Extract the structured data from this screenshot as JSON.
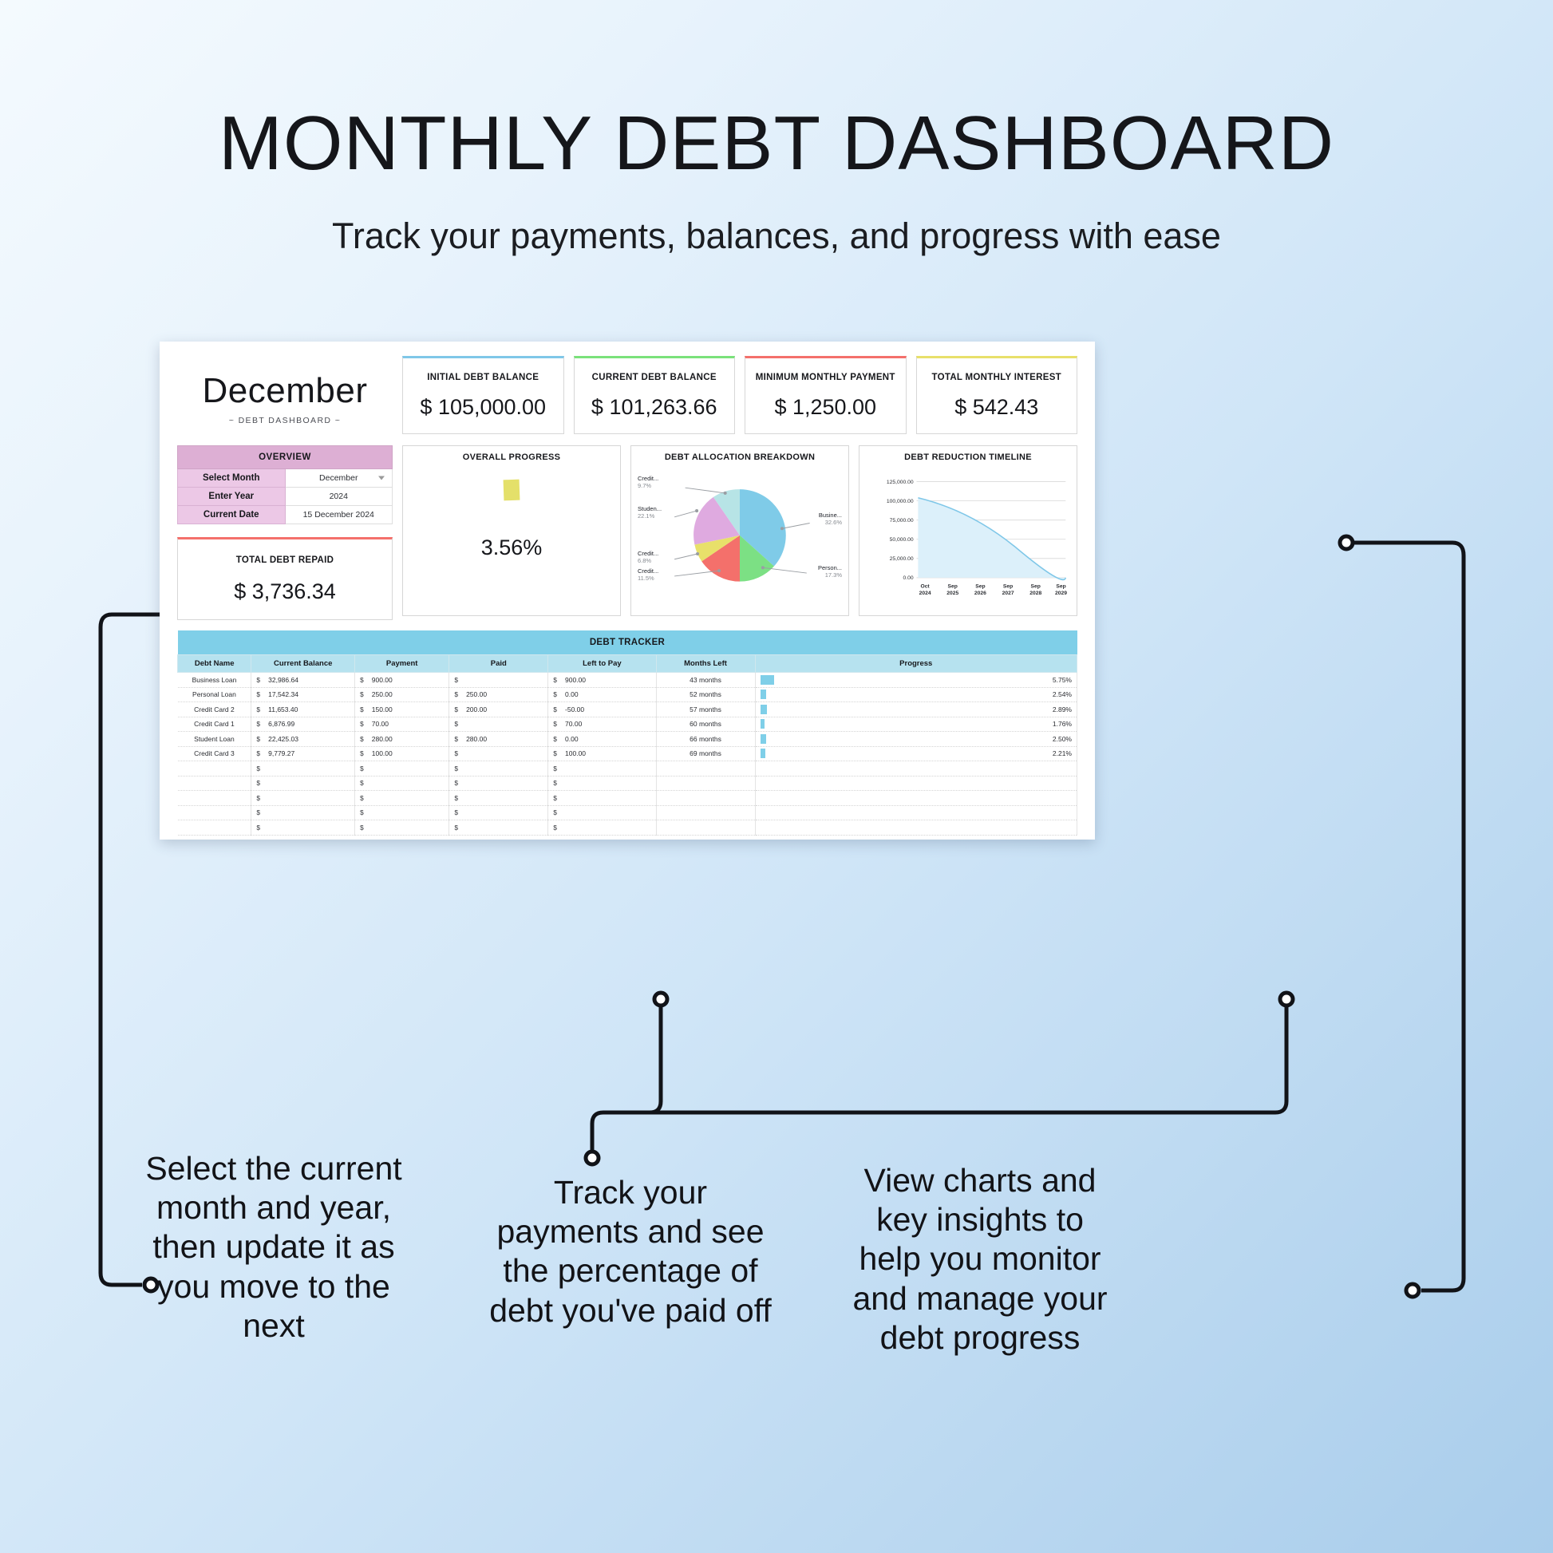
{
  "hero": {
    "title": "MONTHLY DEBT DASHBOARD",
    "subtitle": "Track your payments, balances, and progress with ease"
  },
  "dashboard": {
    "month": "December",
    "caption": "~ DEBT DASHBOARD ~",
    "kpis": [
      {
        "label": "INITIAL DEBT BALANCE",
        "value": "$ 105,000.00",
        "accent": "#7fc7e8"
      },
      {
        "label": "CURRENT DEBT BALANCE",
        "value": "$ 101,263.66",
        "accent": "#7ae27a"
      },
      {
        "label": "MINIMUM MONTHLY PAYMENT",
        "value": "$ 1,250.00",
        "accent": "#f4706b"
      },
      {
        "label": "TOTAL MONTHLY INTEREST",
        "value": "$ 542.43",
        "accent": "#e8e06a"
      }
    ],
    "overview": {
      "title": "OVERVIEW",
      "rows": [
        {
          "key": "Select Month",
          "value": "December",
          "dropdown": true
        },
        {
          "key": "Enter Year",
          "value": "2024",
          "dropdown": false
        },
        {
          "key": "Current Date",
          "value": "15 December 2024",
          "dropdown": false
        }
      ]
    },
    "total_repaid": {
      "label": "TOTAL DEBT REPAID",
      "value": "$ 3,736.34",
      "accent": "#f4706b"
    },
    "overall_progress": {
      "title": "OVERALL PROGRESS",
      "value": "3.56%"
    },
    "tracker": {
      "band": "DEBT TRACKER",
      "columns": [
        "Debt Name",
        "Current Balance",
        "Payment",
        "Paid",
        "Left to Pay",
        "Months Left",
        "Progress"
      ],
      "rows": [
        {
          "name": "Business Loan",
          "balance": "32,986.64",
          "payment": "900.00",
          "paid": "",
          "left": "900.00",
          "months": "43 months",
          "pct": "5.75%",
          "bar": 5.75
        },
        {
          "name": "Personal Loan",
          "balance": "17,542.34",
          "payment": "250.00",
          "paid": "250.00",
          "left": "0.00",
          "months": "52 months",
          "pct": "2.54%",
          "bar": 2.54
        },
        {
          "name": "Credit Card 2",
          "balance": "11,653.40",
          "payment": "150.00",
          "paid": "200.00",
          "left": "-50.00",
          "months": "57 months",
          "pct": "2.89%",
          "bar": 2.89
        },
        {
          "name": "Credit Card 1",
          "balance": "6,876.99",
          "payment": "70.00",
          "paid": "",
          "left": "70.00",
          "months": "60 months",
          "pct": "1.76%",
          "bar": 1.76
        },
        {
          "name": "Student Loan",
          "balance": "22,425.03",
          "payment": "280.00",
          "paid": "280.00",
          "left": "0.00",
          "months": "66 months",
          "pct": "2.50%",
          "bar": 2.5
        },
        {
          "name": "Credit Card 3",
          "balance": "9,779.27",
          "payment": "100.00",
          "paid": "",
          "left": "100.00",
          "months": "69 months",
          "pct": "2.21%",
          "bar": 2.21
        },
        {
          "name": "",
          "balance": "",
          "payment": "",
          "paid": "",
          "left": "",
          "months": "",
          "pct": "",
          "bar": 0
        },
        {
          "name": "",
          "balance": "",
          "payment": "",
          "paid": "",
          "left": "",
          "months": "",
          "pct": "",
          "bar": 0
        },
        {
          "name": "",
          "balance": "",
          "payment": "",
          "paid": "",
          "left": "",
          "months": "",
          "pct": "",
          "bar": 0
        },
        {
          "name": "",
          "balance": "",
          "payment": "",
          "paid": "",
          "left": "",
          "months": "",
          "pct": "",
          "bar": 0
        },
        {
          "name": "",
          "balance": "",
          "payment": "",
          "paid": "",
          "left": "",
          "months": "",
          "pct": "",
          "bar": 0
        }
      ],
      "currency_symbol": "$"
    }
  },
  "callouts": [
    {
      "text": "Select the current month and year, then update it as you move to the next"
    },
    {
      "text": "Track your payments and see the percentage of debt you've paid off"
    },
    {
      "text": "View charts and key insights to help you monitor and manage your debt progress"
    }
  ],
  "chart_data": [
    {
      "type": "pie",
      "title": "DEBT ALLOCATION BREAKDOWN",
      "labels": [
        "Busine...",
        "Person...",
        "Credit...",
        "Credit...",
        "Studen...",
        "Credit..."
      ],
      "values": [
        32.6,
        17.3,
        11.5,
        6.8,
        22.1,
        9.7
      ],
      "value_labels": [
        "32.6%",
        "17.3%",
        "11.5%",
        "6.8%",
        "22.1%",
        "9.7%"
      ],
      "colors": [
        "#7fcbe8",
        "#7ce084",
        "#f4706b",
        "#e8e06a",
        "#dfaae0",
        "#b7e4e6"
      ],
      "legend": "callouts"
    },
    {
      "type": "area",
      "title": "DEBT REDUCTION TIMELINE",
      "x": [
        "Oct\n2024",
        "Sep\n2025",
        "Sep\n2026",
        "Sep\n2027",
        "Sep\n2028",
        "Sep\n2029"
      ],
      "xticklabels": [
        [
          "Oct",
          "2024"
        ],
        [
          "Sep",
          "2025"
        ],
        [
          "Sep",
          "2026"
        ],
        [
          "Sep",
          "2027"
        ],
        [
          "Sep",
          "2028"
        ],
        [
          "Sep",
          "2029"
        ]
      ],
      "yticklabels": [
        "125,000.00",
        "100,000.00",
        "75,000.00",
        "50,000.00",
        "25,000.00",
        "0.00"
      ],
      "ylim": [
        0,
        125000
      ],
      "values": [
        103000,
        90500,
        74000,
        52500,
        28000,
        3000
      ],
      "end_value": 0,
      "line_color": "#7fc7e8",
      "fill_color": "#dcf0fa",
      "grid": true
    }
  ]
}
